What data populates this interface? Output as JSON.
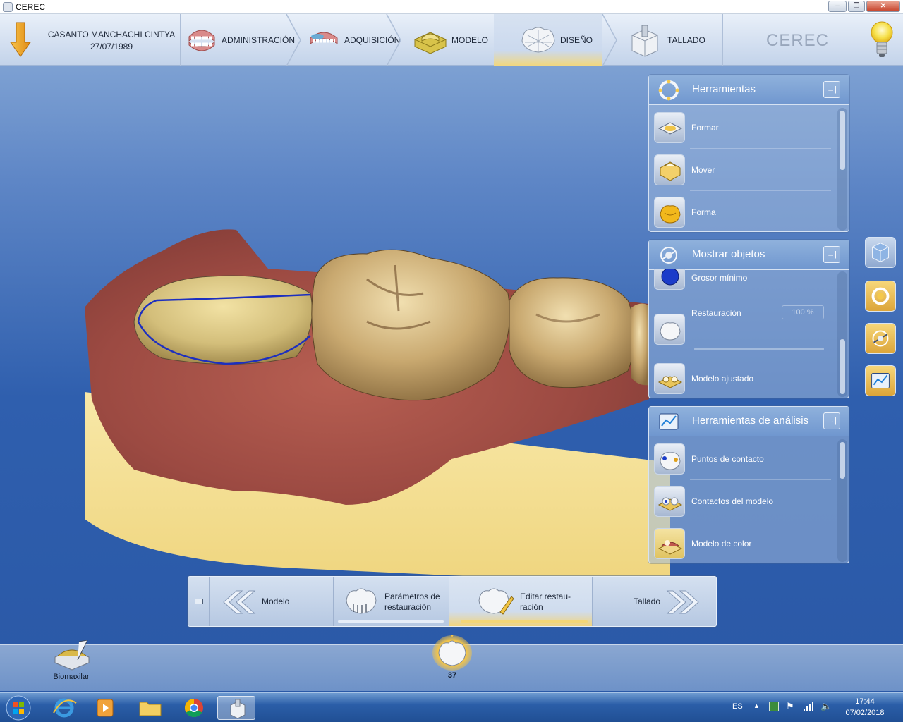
{
  "window": {
    "title": "CEREC"
  },
  "patient": {
    "name": "CASANTO MANCHACHI CINTYA",
    "dob": "27/07/1989"
  },
  "nav": {
    "steps": [
      {
        "label": "ADMINISTRACIÓN",
        "icon": "dentures-icon"
      },
      {
        "label": "ADQUISICIÓN",
        "icon": "scan-icon"
      },
      {
        "label": "MODELO",
        "icon": "model-base-icon"
      },
      {
        "label": "DISEÑO",
        "icon": "design-crown-icon",
        "active": true
      },
      {
        "label": "TALLADO",
        "icon": "milling-icon"
      }
    ],
    "brand": "CEREC"
  },
  "panels": {
    "herramientas": {
      "title": "Herramientas",
      "items": [
        {
          "label": "Formar",
          "icon": "shape-tool-icon"
        },
        {
          "label": "Mover",
          "icon": "move-tool-icon"
        },
        {
          "label": "Forma",
          "icon": "form-tool-icon"
        }
      ]
    },
    "mostrar": {
      "title": "Mostrar objetos",
      "items": [
        {
          "label": "Grosor mínimo",
          "icon": "min-thickness-icon"
        },
        {
          "label": "Restauración",
          "icon": "restoration-icon",
          "value": "100 %"
        },
        {
          "label": "Modelo ajustado",
          "icon": "trimmed-model-icon"
        }
      ]
    },
    "analisis": {
      "title": "Herramientas de análisis",
      "items": [
        {
          "label": "Puntos de contacto",
          "icon": "contact-points-icon"
        },
        {
          "label": "Contactos del modelo",
          "icon": "model-contacts-icon"
        },
        {
          "label": "Modelo de color",
          "icon": "color-model-icon"
        }
      ]
    }
  },
  "workflow": {
    "back_label": "Modelo",
    "step1_line1": "Parámetros de",
    "step1_line2": "restauración",
    "step2_line1": "Editar restau-",
    "step2_line2": "ración",
    "next_label": "Tallado"
  },
  "bottom": {
    "biomaxilar_label": "Biomaxilar",
    "tooth_number": "37"
  },
  "taskbar": {
    "lang": "ES",
    "time": "17:44",
    "date": "07/02/2018"
  },
  "colors": {
    "accent": "#f0c548",
    "panel": "#7a9fd3",
    "gingiva": "#a8524a",
    "base": "#f4e09a"
  }
}
